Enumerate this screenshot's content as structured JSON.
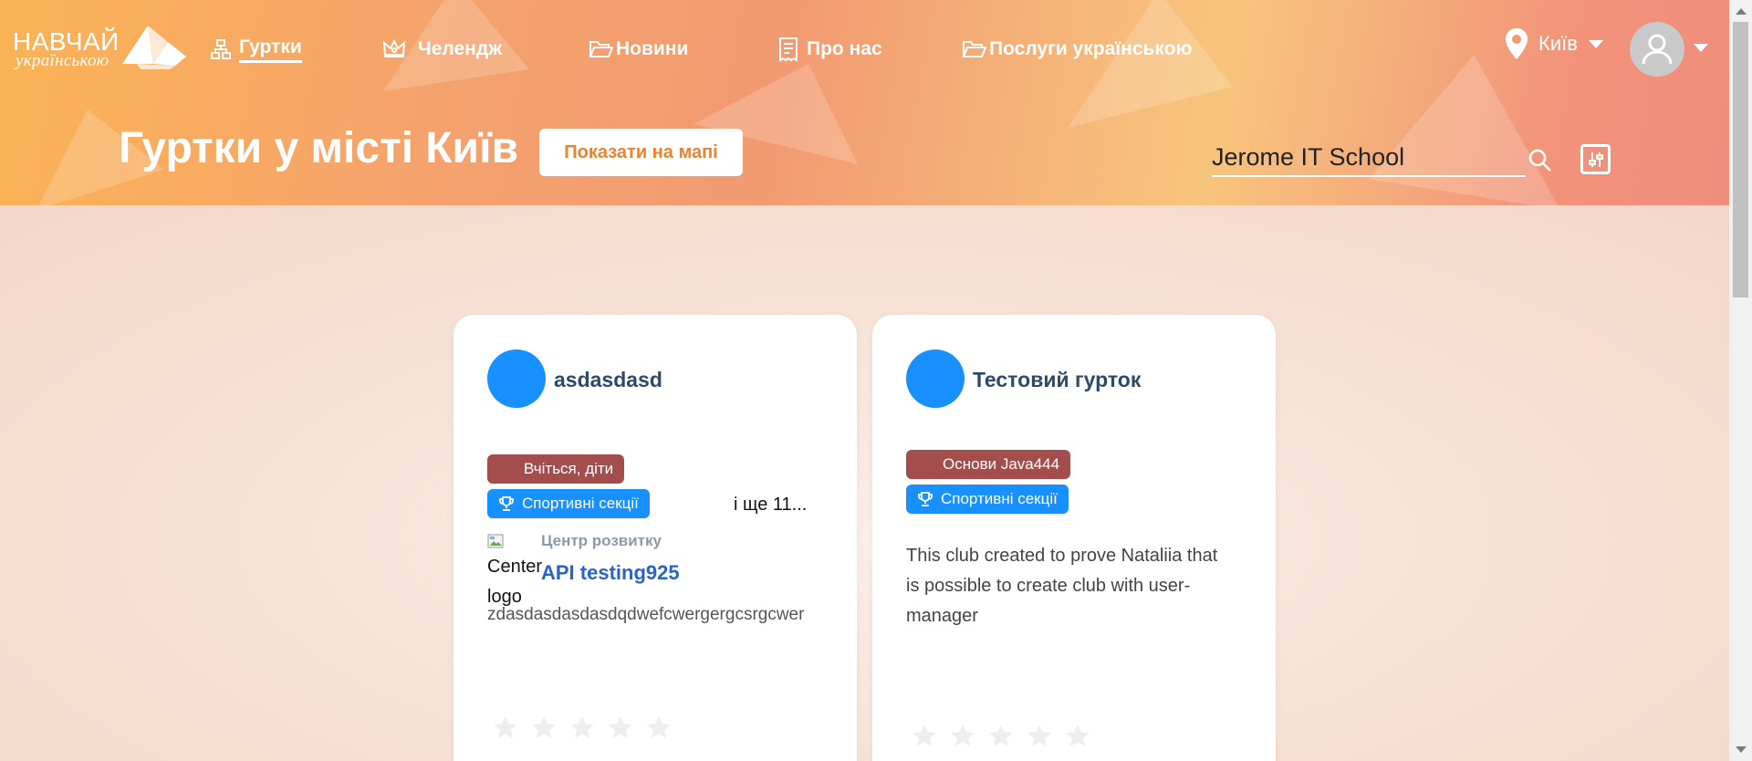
{
  "header": {
    "logo_top": "НАВЧАЙ",
    "logo_bottom": "українською",
    "nav": [
      {
        "label": "Гуртки",
        "icon": "hierarchy-icon",
        "active": true
      },
      {
        "label": "Челендж",
        "icon": "crown-icon",
        "active": false
      },
      {
        "label": "Новини",
        "icon": "folder-open-icon",
        "active": false
      },
      {
        "label": "Про нас",
        "icon": "document-icon",
        "active": false
      },
      {
        "label": "Послуги українською",
        "icon": "folder-open-icon",
        "active": false
      }
    ],
    "city": "Київ",
    "page_title": "Гуртки у місті Київ",
    "map_button": "Показати на мапі",
    "search_value": "Jerome IT School"
  },
  "cards": [
    {
      "title": "asdasdasd",
      "tags": [
        {
          "label": "Вчіться, діти",
          "color": "#a44d4d"
        },
        {
          "label": "Спортивні секції",
          "color": "#1890ff",
          "icon": "trophy-icon"
        }
      ],
      "more": "і ще 11...",
      "center_caption": "Центр розвитку",
      "center_img_alt_1": "Center",
      "center_img_alt_2": "logo",
      "center_name": "API testing925",
      "center_desc": "zdasdasdasdasdqdwefcwergergcsrgcwer",
      "rating": 0
    },
    {
      "title": "Тестовий гурток",
      "tags": [
        {
          "label": "Основи Java444",
          "color": "#a44d4d"
        },
        {
          "label": "Спортивні секції",
          "color": "#1890ff",
          "icon": "trophy-icon"
        }
      ],
      "description_line1": "This club created to prove Nataliia that",
      "description_line2": "is possible to create club with user-",
      "description_line3": "manager",
      "rating": 0
    }
  ],
  "colors": {
    "accent_orange": "#f0802e",
    "avatar_blue": "#1890ff",
    "tag_red": "#a44d4d",
    "link_blue": "#2a63c7"
  }
}
